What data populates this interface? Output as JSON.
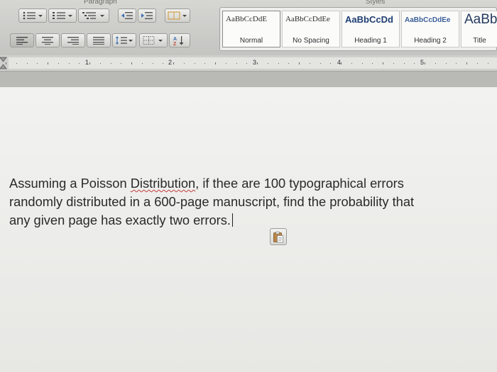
{
  "ribbon": {
    "paragraph_label": "Paragraph",
    "styles_label": "Styles",
    "styles": [
      {
        "preview": "AaBbCcDdE",
        "name": "Normal"
      },
      {
        "preview": "AaBbCcDdEe",
        "name": "No Spacing"
      },
      {
        "preview": "AaBbCcDd",
        "name": "Heading 1"
      },
      {
        "preview": "AaBbCcDdEe",
        "name": "Heading 2"
      },
      {
        "preview": "AaBb",
        "name": "Title"
      }
    ]
  },
  "ruler": {
    "numbers": [
      "1",
      "2",
      "3",
      "4",
      "5"
    ]
  },
  "document": {
    "before_underline": "Assuming a Poisson ",
    "underlined_word": "Distribution",
    "line1_rest": ", if thee are 100 typographical errors",
    "line2": "randomly distributed in a 600-page manuscript, find the probability that",
    "line3": "any given page has exactly two errors."
  },
  "icons": {
    "paste": "paste-options-icon",
    "tab_marker": "tab-stop-marker-icon"
  },
  "colors": {
    "page": "#efefed",
    "ribbon": "#cfcfcc",
    "text": "#2a2a2a",
    "spell_underline": "#c23b3b"
  }
}
